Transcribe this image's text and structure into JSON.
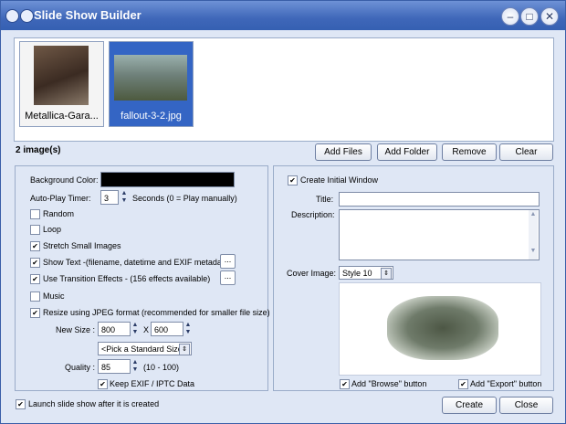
{
  "window": {
    "title": "Slide Show Builder"
  },
  "thumbnails": [
    {
      "label": "Metallica-Gara...",
      "selected": false
    },
    {
      "label": "fallout-3-2.jpg",
      "selected": true
    }
  ],
  "image_count": "2 image(s)",
  "toolbar": {
    "add_files": "Add Files",
    "add_folder": "Add Folder",
    "remove": "Remove",
    "clear": "Clear"
  },
  "left": {
    "background_color_label": "Background Color:",
    "background_color": "#000000",
    "autoplay_label": "Auto-Play Timer:",
    "autoplay_value": "3",
    "autoplay_suffix": "Seconds (0 = Play  manually)",
    "random": "Random",
    "loop": "Loop",
    "stretch": "Stretch Small Images",
    "show_text": "Show Text -(filename, datetime and EXIF metadata)",
    "show_text_more": "...",
    "transitions": "Use Transition Effects    -    (156 effects available)",
    "transitions_more": "...",
    "music": "Music",
    "resize": "Resize using JPEG format (recommended for smaller file size)",
    "new_size_label": "New Size :",
    "width": "800",
    "x": "X",
    "height": "600",
    "standard_size": "<Pick a Standard Size>",
    "quality_label": "Quality :",
    "quality": "85",
    "quality_range": "(10 - 100)",
    "keep_exif": "Keep EXIF / IPTC Data",
    "checks": {
      "random": false,
      "loop": false,
      "stretch": true,
      "show_text": true,
      "transitions": true,
      "music": false,
      "resize": true,
      "keep_exif": true
    }
  },
  "right": {
    "create_initial": "Create Initial Window",
    "create_initial_checked": true,
    "title_label": "Title:",
    "title_value": "",
    "description_label": "Description:",
    "description_value": "",
    "cover_label": "Cover Image:",
    "cover_value": "Style 10",
    "add_browse": "Add \"Browse\" button",
    "add_export": "Add \"Export\" button",
    "add_browse_checked": true,
    "add_export_checked": true
  },
  "footer": {
    "launch": "Launch slide show after it is created",
    "launch_checked": true,
    "create": "Create",
    "close": "Close"
  }
}
